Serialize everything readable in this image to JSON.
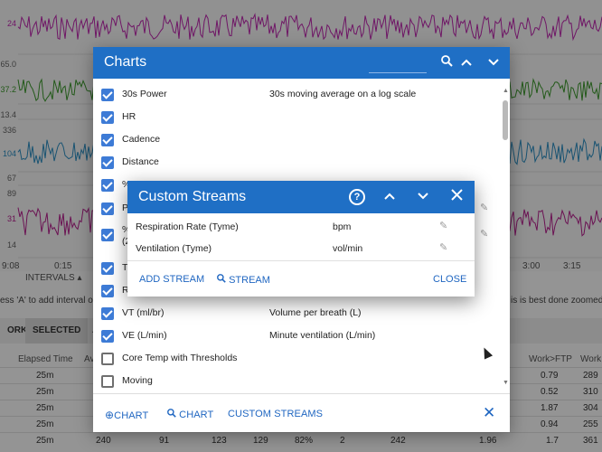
{
  "background": {
    "y_axis_labels": [
      "24",
      "65.0",
      "37.2",
      "13.4",
      "336",
      "104",
      "67",
      "89",
      "31",
      "14"
    ],
    "time_labels": [
      "9:08",
      "0:15",
      "3:00",
      "3:15"
    ],
    "intervals_label": "INTERVALS",
    "hint_left": "ess 'A' to add interval or S",
    "hint_right": "is is best done zoomed in",
    "tabs": [
      "ORK",
      "SELECTED",
      "A"
    ],
    "table_headers": [
      "Elapsed Time",
      "Av",
      "Work>FTP",
      "Work"
    ],
    "table_rows": [
      {
        "time": "25m",
        "wftp": "0.79",
        "work": "289"
      },
      {
        "time": "25m",
        "wftp": "0.52",
        "work": "310"
      },
      {
        "time": "25m",
        "wftp": "1.87",
        "work": "304"
      },
      {
        "time": "25m",
        "wftp": "0.94",
        "work": "255"
      },
      {
        "time": "25m",
        "c1": "240",
        "c2": "91",
        "c3": "123",
        "c4": "129",
        "c5": "82%",
        "c6": "2",
        "c7": "242",
        "c8": "1.96",
        "wftp": "1.7",
        "work": "361"
      }
    ],
    "colors": {
      "pink": "#c026b0",
      "green": "#3c9a2b",
      "blue": "#2b8fc4",
      "magenta": "#b81f8f"
    }
  },
  "charts_dialog": {
    "title": "Charts",
    "items": [
      {
        "label": "30s Power",
        "desc": "30s moving average on a log scale",
        "checked": true
      },
      {
        "label": "HR",
        "desc": "",
        "checked": true
      },
      {
        "label": "Cadence",
        "desc": "",
        "checked": true
      },
      {
        "label": "Distance",
        "desc": "",
        "checked": true
      },
      {
        "label": "% FTP",
        "desc": "",
        "checked": true
      },
      {
        "label": "P",
        "desc": "",
        "checked": true
      },
      {
        "label": "% (2",
        "desc": "",
        "checked": true
      },
      {
        "label": "T",
        "desc": "",
        "checked": true
      },
      {
        "label": "R",
        "desc": "",
        "checked": true
      },
      {
        "label": "VT (ml/br)",
        "desc": "Volume per breath (L)",
        "checked": true
      },
      {
        "label": "VE (L/min)",
        "desc": "Minute ventilation (L/min)",
        "checked": true
      },
      {
        "label": "Core Temp with Thresholds",
        "desc": "",
        "checked": false
      },
      {
        "label": "Moving",
        "desc": "",
        "checked": false
      }
    ],
    "footer": {
      "add_chart": "CHART",
      "search_chart": "CHART",
      "custom_streams": "CUSTOM STREAMS"
    }
  },
  "custom_streams_dialog": {
    "title": "Custom Streams",
    "streams": [
      {
        "name": "Respiration Rate (Tyme)",
        "unit": "bpm"
      },
      {
        "name": "Ventilation (Tyme)",
        "unit": "vol/min"
      }
    ],
    "add_stream": "ADD STREAM",
    "search_stream": "STREAM",
    "close": "CLOSE",
    "help_symbol": "?"
  }
}
